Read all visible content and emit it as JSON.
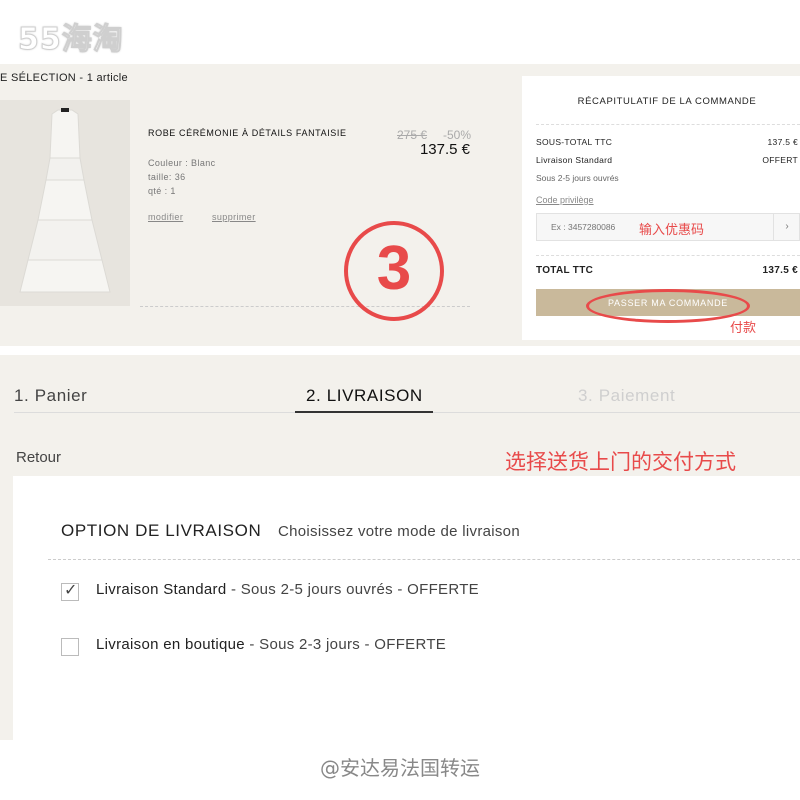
{
  "watermark": {
    "logo": "55海淘",
    "footer": "@安达易法国转运"
  },
  "colors": {
    "accent_red": "#e84a4a",
    "checkout_button": "#c9b99b",
    "page_bg": "#f3f1ec"
  },
  "cart": {
    "selection_title": "E SÉLECTION - 1 article",
    "item": {
      "name": "ROBE CÉRÉMONIE À DÉTAILS FANTAISIE",
      "old_price": "275 €",
      "discount": "-50%",
      "price": "137.5 €",
      "color": "Couleur : Blanc",
      "size": "taille: 36",
      "qty": "qté : 1",
      "modify": "modifier",
      "delete": "supprimer"
    },
    "step_badge": "3"
  },
  "summary": {
    "title": "RÉCAPITULATIF DE LA COMMANDE",
    "subtotal_label": "SOUS-TOTAL TTC",
    "subtotal_value": "137.5 €",
    "shipping_label": "Livraison Standard",
    "shipping_value": "OFFERT",
    "delivery_days": "Sous 2-5 jours ouvrés",
    "promo_link": "Code privilège",
    "promo_placeholder": "Ex : 3457280086",
    "promo_arrow_icon": "chevron-right-icon",
    "promo_note": "输入优惠码",
    "total_label": "TOTAL TTC",
    "total_value": "137.5 €",
    "order_button": "PASSER MA COMMANDE",
    "pay_note": "付款"
  },
  "delivery": {
    "steps": [
      "1. Panier",
      "2. LIVRAISON",
      "3. Paiement"
    ],
    "active_step": 2,
    "back": "Retour",
    "options_title": "OPTION DE LIVRAISON",
    "options_subtitle": "Choisissez votre mode de livraison",
    "options": [
      {
        "name": "Livraison Standard",
        "detail": " - Sous 2-5 jours ouvrés - OFFERTE",
        "checked": true
      },
      {
        "name": "Livraison en boutique",
        "detail": " - Sous 2-3 jours - OFFERTE",
        "checked": false
      }
    ],
    "choose_note": "选择送货上门的交付方式"
  }
}
